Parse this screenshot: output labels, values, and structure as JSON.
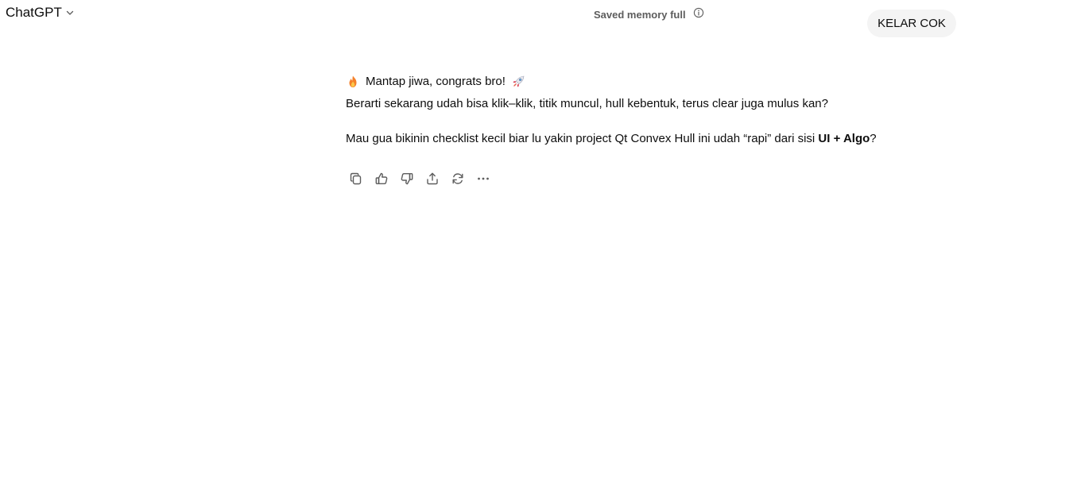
{
  "header": {
    "model_name": "ChatGPT",
    "model_dropdown_icon": "chevron-down-icon",
    "memory_notice": "Saved memory full",
    "memory_info_icon": "info-icon"
  },
  "conversation": {
    "user_message": "KELAR COK",
    "assistant": {
      "line1_text": "Mantap jiwa, congrats bro!",
      "line1_leading_emoji": "fire-emoji",
      "line1_trailing_emoji": "rocket-emoji",
      "line2_text": "Berarti sekarang udah bisa klik–klik, titik muncul, hull kebentuk, terus clear juga mulus kan?",
      "para2_prefix": "Mau gua bikinin checklist kecil biar lu yakin project Qt Convex Hull ini udah “rapi” dari sisi ",
      "para2_bold": "UI + Algo",
      "para2_suffix": "?"
    },
    "actions": [
      {
        "name": "copy-button",
        "icon": "copy-icon"
      },
      {
        "name": "good-response-button",
        "icon": "thumbs-up-icon"
      },
      {
        "name": "bad-response-button",
        "icon": "thumbs-down-icon"
      },
      {
        "name": "share-button",
        "icon": "share-icon"
      },
      {
        "name": "regenerate-button",
        "icon": "refresh-icon"
      },
      {
        "name": "more-actions-button",
        "icon": "more-horizontal-icon"
      }
    ]
  },
  "colors": {
    "text_primary": "#0d0d0d",
    "text_secondary": "#5d5d5d",
    "bubble_bg": "#f4f4f4",
    "icon_color": "#5d5d5d"
  }
}
